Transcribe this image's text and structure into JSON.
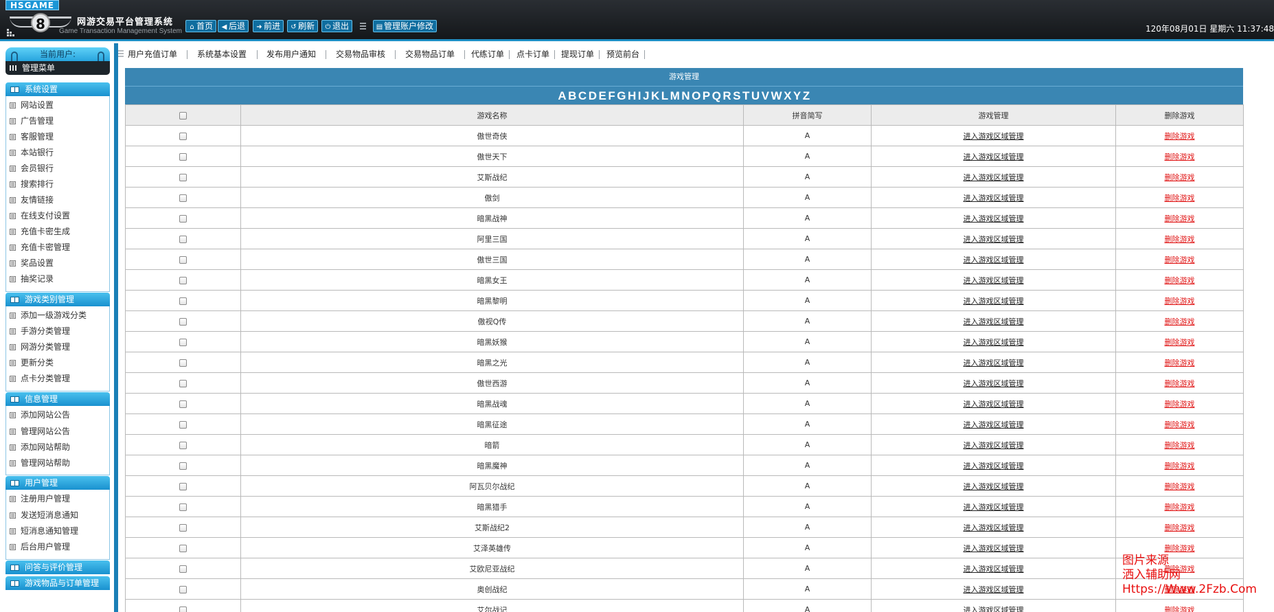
{
  "header": {
    "brand_tag": "HSGAME",
    "logo_badge": "8",
    "title_cn": "网游交易平台管理系统",
    "title_en": "Game Transaction Management System",
    "toolbar": [
      {
        "name": "home-button",
        "icon": "⌂",
        "label": "首页"
      },
      {
        "name": "back-button",
        "icon": "◀",
        "label": "后退"
      },
      {
        "name": "forward-button",
        "icon": "➜",
        "label": "前进"
      },
      {
        "name": "refresh-button",
        "icon": "↺",
        "label": "刷新"
      },
      {
        "name": "logout-button",
        "icon": "⏻",
        "label": "退出"
      },
      {
        "name": "account-edit-button",
        "icon": "▤",
        "label": "管理账户修改"
      }
    ],
    "datetime": "120年08月01日 星期六 11:37:48"
  },
  "sidebar": {
    "current_user_label": "当前用户:",
    "menu_title": "管理菜单",
    "groups": [
      {
        "title": "系统设置",
        "items": [
          "网站设置",
          "广告管理",
          "客服管理",
          "本站银行",
          "会员银行",
          "搜索排行",
          "友情链接",
          "在线支付设置",
          "充值卡密生成",
          "充值卡密管理",
          "奖品设置",
          "抽奖记录"
        ]
      },
      {
        "title": "游戏类别管理",
        "items": [
          "添加一级游戏分类",
          "手游分类管理",
          "网游分类管理",
          "更新分类",
          "点卡分类管理"
        ]
      },
      {
        "title": "信息管理",
        "items": [
          "添加网站公告",
          "管理网站公告",
          "添加网站帮助",
          "管理网站帮助"
        ]
      },
      {
        "title": "用户管理",
        "items": [
          "注册用户管理",
          "发送短消息通知",
          "短消息通知管理",
          "后台用户管理"
        ]
      },
      {
        "title": "问答与评价管理",
        "items": []
      },
      {
        "title": "游戏物品与订单管理",
        "items": []
      }
    ]
  },
  "nav_tabs": [
    "用户充值订单",
    "系统基本设置",
    "发布用户通知",
    "交易物品审核",
    "交易物品订单",
    "代练订单",
    "点卡订单",
    "提现订单",
    "预览前台"
  ],
  "table": {
    "caption": "游戏管理",
    "letters": [
      "A",
      "B",
      "C",
      "D",
      "E",
      "F",
      "G",
      "H",
      "I",
      "J",
      "K",
      "L",
      "M",
      "N",
      "O",
      "P",
      "Q",
      "R",
      "S",
      "T",
      "U",
      "V",
      "W",
      "X",
      "Y",
      "Z"
    ],
    "headers": [
      "游戏名称",
      "拼音简写",
      "游戏管理",
      "删除游戏"
    ],
    "manage_label": "进入游戏区域管理",
    "delete_label": "删除游戏",
    "rows": [
      {
        "name": "傲世奇侠",
        "pinyin": "A"
      },
      {
        "name": "傲世天下",
        "pinyin": "A"
      },
      {
        "name": "艾斯战纪",
        "pinyin": "A"
      },
      {
        "name": "傲剑",
        "pinyin": "A"
      },
      {
        "name": "暗黑战神",
        "pinyin": "A"
      },
      {
        "name": "阿里三国",
        "pinyin": "A"
      },
      {
        "name": "傲世三国",
        "pinyin": "A"
      },
      {
        "name": "暗黑女王",
        "pinyin": "A"
      },
      {
        "name": "暗黑黎明",
        "pinyin": "A"
      },
      {
        "name": "傲视Q传",
        "pinyin": "A"
      },
      {
        "name": "暗黑妖猴",
        "pinyin": "A"
      },
      {
        "name": "暗黑之光",
        "pinyin": "A"
      },
      {
        "name": "傲世西游",
        "pinyin": "A"
      },
      {
        "name": "暗黑战魂",
        "pinyin": "A"
      },
      {
        "name": "暗黑征途",
        "pinyin": "A"
      },
      {
        "name": "暗箭",
        "pinyin": "A"
      },
      {
        "name": "暗黑魔神",
        "pinyin": "A"
      },
      {
        "name": "阿瓦贝尔战纪",
        "pinyin": "A"
      },
      {
        "name": "暗黑猎手",
        "pinyin": "A"
      },
      {
        "name": "艾斯战纪2",
        "pinyin": "A"
      },
      {
        "name": "艾泽英雄传",
        "pinyin": "A"
      },
      {
        "name": "艾欧尼亚战纪",
        "pinyin": "A"
      },
      {
        "name": "奥创战纪",
        "pinyin": "A"
      },
      {
        "name": "艾尔战记",
        "pinyin": "A"
      }
    ]
  },
  "watermark": [
    "图片来源",
    "洒入辅助网",
    "Https://Www.2Fzb.Com"
  ]
}
